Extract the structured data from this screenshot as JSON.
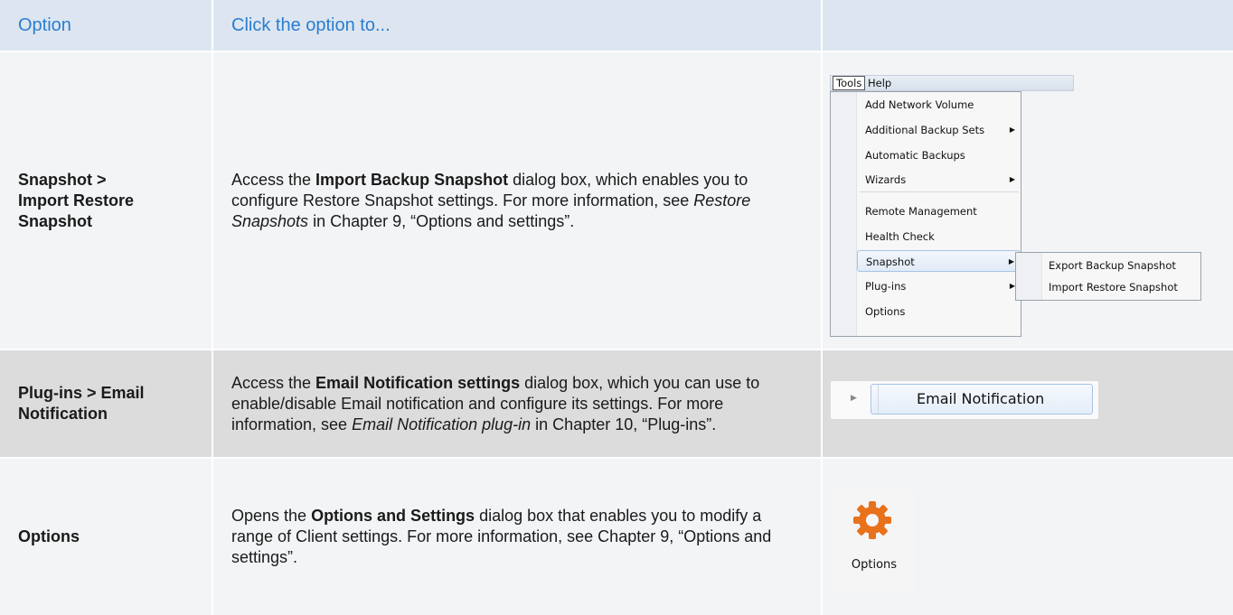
{
  "header": {
    "col1": "Option",
    "col2": "Click the option to..."
  },
  "rows": [
    {
      "option_lines": [
        "Snapshot >",
        "Import Restore",
        "Snapshot"
      ],
      "desc": {
        "p1": "Access the ",
        "b1": "Import Backup Snapshot",
        "p2": " dialog box, which enables you to configure Restore Snapshot settings. For more information, see ",
        "i1": "Restore Snapshots",
        "p3": " in Chapter 9, “Options and settings”."
      }
    },
    {
      "option_lines": [
        "Plug-ins > Email",
        "Notification"
      ],
      "desc": {
        "p1": "Access the ",
        "b1": "Email Notification settings",
        "p2": " dialog box, which you can use to enable/disable Email notification and configure its settings. For more information, see ",
        "i1": "Email Notification plug-in",
        "p3": " in Chapter 10, “Plug-ins”."
      }
    },
    {
      "option_lines": [
        "Options"
      ],
      "desc": {
        "p1": "Opens the ",
        "b1": "Options and Settings",
        "p2": " dialog box that enables you to modify a range of Client settings. For more information, see Chapter 9, “Options and settings”."
      }
    }
  ],
  "tools_menu": {
    "menubar": [
      "Tools",
      "Help"
    ],
    "items": [
      {
        "label": "Add Network Volume",
        "has_submenu": false
      },
      {
        "label": "Additional Backup Sets",
        "has_submenu": true
      },
      {
        "label": "Automatic Backups",
        "has_submenu": false
      },
      {
        "label": "Wizards",
        "has_submenu": true
      },
      {
        "label": "Remote Management",
        "has_submenu": false
      },
      {
        "label": "Health Check",
        "has_submenu": false
      },
      {
        "label": "Snapshot",
        "has_submenu": true,
        "highlighted": true
      },
      {
        "label": "Plug-ins",
        "has_submenu": true
      },
      {
        "label": "Options",
        "has_submenu": false
      }
    ],
    "submenu": [
      "Export Backup Snapshot",
      "Import Restore Snapshot"
    ],
    "arrow_glyph": "▶"
  },
  "email_item": {
    "label": "Email Notification",
    "arrow_glyph": "▶"
  },
  "options_icon": {
    "icon": "gear-icon",
    "label": "Options",
    "color": "#e8711c"
  }
}
